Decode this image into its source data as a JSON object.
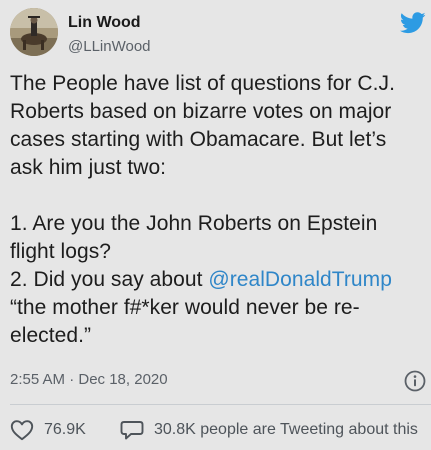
{
  "author": {
    "display_name": "Lin Wood",
    "handle": "@LLinWood"
  },
  "tweet": {
    "lines": [
      "The People have list of questions for C.J.",
      "Roberts based on bizarre votes on major",
      "cases starting with Obamacare. But let’s",
      "ask him just two:",
      "1. Are you the John Roberts on Epstein",
      "flight logs?",
      "2. Did you say about ",
      "“the mother f#*ker would never be re-",
      "elected.”"
    ],
    "mention": "@realDonaldTrump"
  },
  "timestamp": "2:55 AM · Dec 18, 2020",
  "actions": {
    "likes": "76.9K",
    "replies_text": "30.8K people are Tweeting about this"
  },
  "colors": {
    "background": "#e6e6e6",
    "link": "#2f86c8",
    "twitter_brand": "#2d9be3",
    "like_icon": "#4e545a"
  },
  "icons": {
    "brand": "twitter-bird-icon",
    "info": "info-icon",
    "like": "heart-icon",
    "reply": "speech-bubble-icon"
  }
}
